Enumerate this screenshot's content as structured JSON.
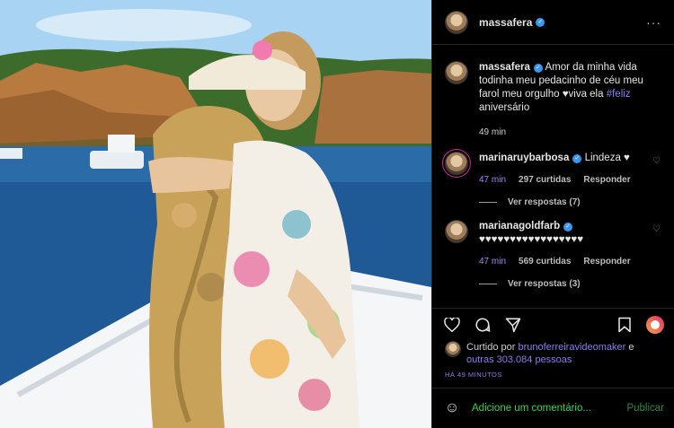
{
  "post": {
    "username": "massafera",
    "more_label": "···"
  },
  "caption": {
    "username": "massafera",
    "text": "Amor da minha vida todinha meu pedacinho de céu meu farol meu orgulho ♥viva ela",
    "hashtag": "#feliz",
    "text_after": "aniversário",
    "time": "49 min"
  },
  "comments": [
    {
      "username": "marinaruybarbosa",
      "text": "Lindeza ♥",
      "time": "47 min",
      "likes": "297 curtidas",
      "reply_label": "Responder",
      "replies_label": "Ver respostas (7)"
    },
    {
      "username": "marianagoldfarb",
      "text": "♥♥♥♥♥♥♥♥♥♥♥♥♥♥♥♥♥",
      "time": "47 min",
      "likes": "569 curtidas",
      "reply_label": "Responder",
      "replies_label": "Ver respostas (3)"
    }
  ],
  "likes": {
    "prefix": "Curtido por",
    "user": "brunoferreiravideomaker",
    "conj": "e",
    "others": "outras 303.084 pessoas"
  },
  "timestamp": "HÁ 49 MINUTOS",
  "add_comment": {
    "placeholder": "Adicione um comentário...",
    "publish_label": "Publicar"
  },
  "icons": {
    "verified": "verified-badge-icon",
    "heart": "heart-icon",
    "comment": "comment-bubble-icon",
    "share": "paper-plane-icon",
    "save": "bookmark-icon",
    "story": "story-ring-icon",
    "emoji": "smiley-icon"
  },
  "colors": {
    "background": "#000000",
    "link": "#8a7cf0",
    "verified": "#3897f0",
    "input_text": "#3ad44e"
  }
}
